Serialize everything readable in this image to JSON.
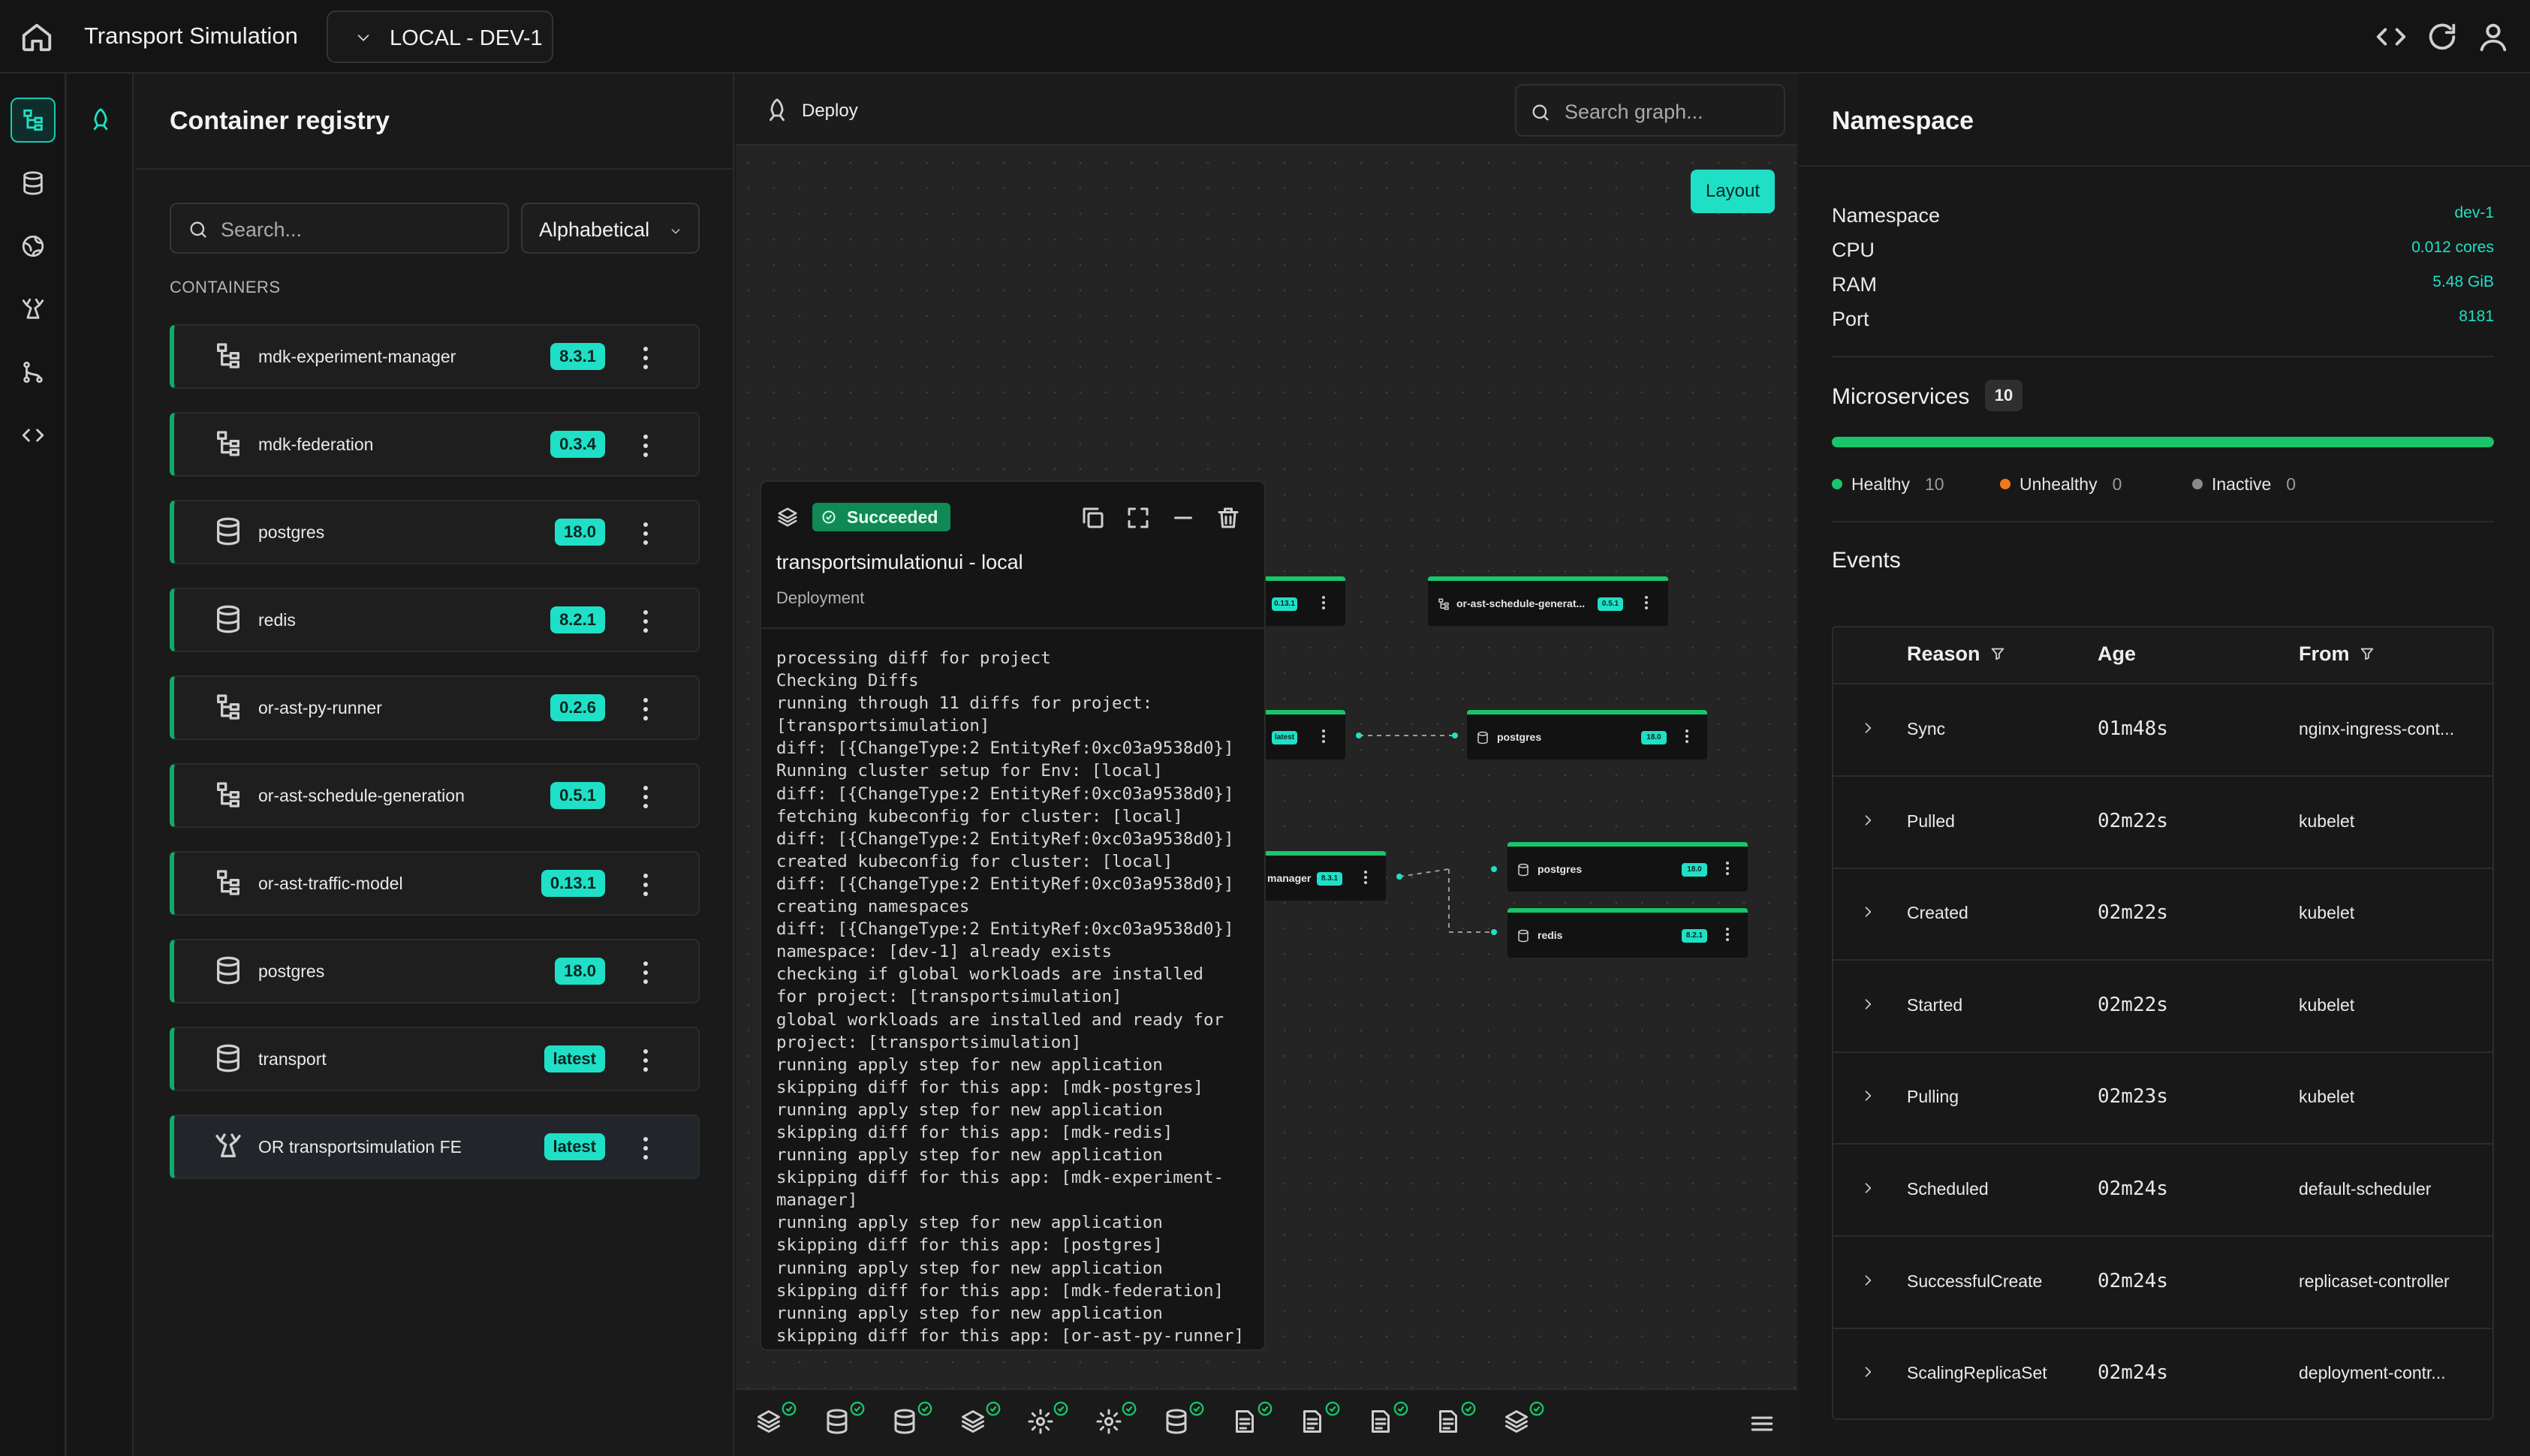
{
  "topbar": {
    "title": "Transport Simulation",
    "environment": "LOCAL - DEV-1"
  },
  "registry": {
    "title": "Container registry",
    "search_placeholder": "Search...",
    "sort": "Alphabetical",
    "section_label": "CONTAINERS",
    "containers": [
      {
        "name": "mdk-experiment-manager",
        "version": "8.3.1",
        "icon": "tree-icon"
      },
      {
        "name": "mdk-federation",
        "version": "0.3.4",
        "icon": "tree-icon"
      },
      {
        "name": "postgres",
        "version": "18.0",
        "icon": "database-icon"
      },
      {
        "name": "redis",
        "version": "8.2.1",
        "icon": "database-icon"
      },
      {
        "name": "or-ast-py-runner",
        "version": "0.2.6",
        "icon": "tree-icon"
      },
      {
        "name": "or-ast-schedule-generation",
        "version": "0.5.1",
        "icon": "tree-icon"
      },
      {
        "name": "or-ast-traffic-model",
        "version": "0.13.1",
        "icon": "tree-icon"
      },
      {
        "name": "postgres",
        "version": "18.0",
        "icon": "database-icon"
      },
      {
        "name": "transport",
        "version": "latest",
        "icon": "database-icon"
      },
      {
        "name": "OR transportsimulation FE",
        "version": "latest",
        "icon": "deer-icon"
      }
    ]
  },
  "graph": {
    "deploy_label": "Deploy",
    "search_placeholder": "Search graph...",
    "layout_label": "Layout",
    "nodes": {
      "n1_badge": "0.13.1",
      "n2_label": "or-ast-schedule-generat...",
      "n2_badge": "0.5.1",
      "n3_badge": "latest",
      "n4_label": "postgres",
      "n4_badge": "18.0",
      "n5_label": "manager",
      "n5_badge": "8.3.1",
      "n6_label": "postgres",
      "n6_badge": "18.0",
      "n7_label": "redis",
      "n7_badge": "8.2.1"
    }
  },
  "deployment": {
    "status": "Succeeded",
    "title": "transportsimulationui - local",
    "subtitle": "Deployment",
    "log": [
      "processing diff for project",
      "Checking Diffs",
      "running through 11 diffs for project:",
      "[transportsimulation]",
      "diff: [{ChangeType:2 EntityRef:0xc03a9538d0}]",
      "Running cluster setup for Env: [local]",
      "diff: [{ChangeType:2 EntityRef:0xc03a9538d0}]",
      "fetching kubeconfig for cluster: [local]",
      "diff: [{ChangeType:2 EntityRef:0xc03a9538d0}]",
      "created kubeconfig for cluster: [local]",
      "diff: [{ChangeType:2 EntityRef:0xc03a9538d0}]",
      "creating namespaces",
      "diff: [{ChangeType:2 EntityRef:0xc03a9538d0}]",
      "namespace: [dev-1] already exists",
      "checking if global workloads are installed",
      "for project: [transportsimulation]",
      "global workloads are installed and ready for",
      "project: [transportsimulation]",
      "running apply step for new application",
      "skipping diff for this app: [mdk-postgres]",
      "running apply step for new application",
      "skipping diff for this app: [mdk-redis]",
      "running apply step for new application",
      "skipping diff for this app: [mdk-experiment-",
      "manager]",
      "running apply step for new application",
      "skipping diff for this app: [postgres]",
      "running apply step for new application",
      "skipping diff for this app: [mdk-federation]",
      "running apply step for new application",
      "skipping diff for this app: [or-ast-py-runner]"
    ]
  },
  "bottom_bar": {
    "icons": [
      "layers-icon",
      "database-icon",
      "database-icon",
      "layers-icon",
      "gear-icon",
      "gear-icon",
      "database-icon",
      "file-list-icon",
      "file-list-icon",
      "file-list-icon",
      "file-list-icon",
      "layers-icon"
    ]
  },
  "namespace": {
    "title": "Namespace",
    "rows": [
      {
        "key": "Namespace",
        "value": "dev-1"
      },
      {
        "key": "CPU",
        "value": "0.012 cores"
      },
      {
        "key": "RAM",
        "value": "5.48 GiB"
      },
      {
        "key": "Port",
        "value": "8181"
      }
    ],
    "microservices_title": "Microservices",
    "microservices_count": "10",
    "healthy_fraction": 1.0,
    "legend": [
      {
        "label": "Healthy",
        "count": "10",
        "color": "#19c56a"
      },
      {
        "label": "Unhealthy",
        "count": "0",
        "color": "#f07a1a"
      },
      {
        "label": "Inactive",
        "count": "0",
        "color": "#8a8a8a"
      }
    ],
    "events_title": "Events",
    "events_columns": {
      "reason": "Reason",
      "age": "Age",
      "from": "From"
    },
    "events": [
      {
        "reason": "Sync",
        "age": "01m48s",
        "from": "nginx-ingress-cont..."
      },
      {
        "reason": "Pulled",
        "age": "02m22s",
        "from": "kubelet"
      },
      {
        "reason": "Created",
        "age": "02m22s",
        "from": "kubelet"
      },
      {
        "reason": "Started",
        "age": "02m22s",
        "from": "kubelet"
      },
      {
        "reason": "Pulling",
        "age": "02m23s",
        "from": "kubelet"
      },
      {
        "reason": "Scheduled",
        "age": "02m24s",
        "from": "default-scheduler"
      },
      {
        "reason": "SuccessfulCreate",
        "age": "02m24s",
        "from": "replicaset-controller"
      },
      {
        "reason": "ScalingReplicaSet",
        "age": "02m24s",
        "from": "deployment-contr..."
      }
    ]
  },
  "colors": {
    "accent": "#1fe0c6",
    "healthy": "#19c56a",
    "status_success": "#0f8a55"
  }
}
